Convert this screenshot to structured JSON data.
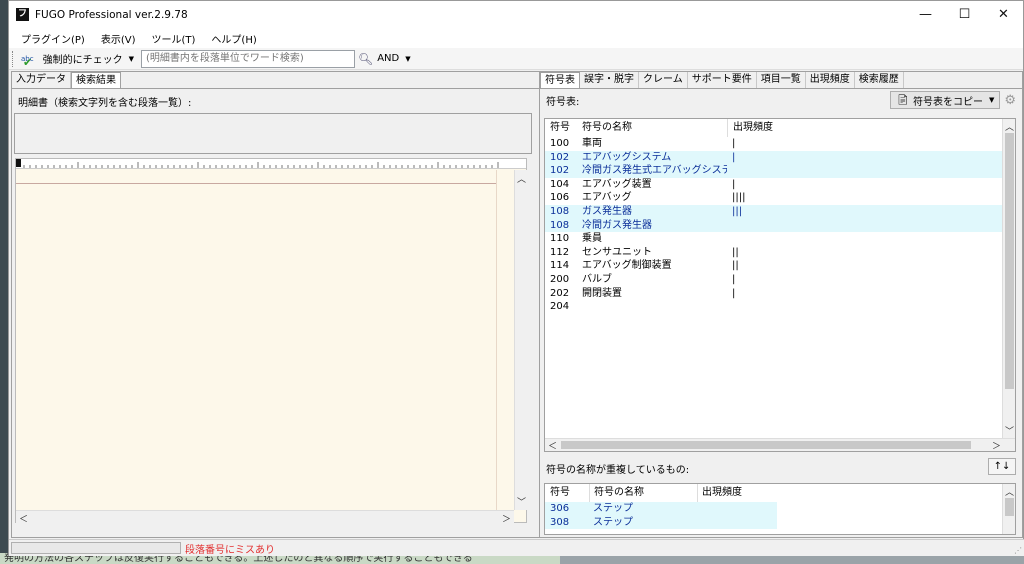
{
  "app": {
    "title": "FUGO Professional ver.2.9.78"
  },
  "background": {
    "bottom_text": "発明の方法の各ステップは反復実行することもできる。上述したのと異なる順序で実行することもできる"
  },
  "menu": [
    "プラグイン(P)",
    "表示(V)",
    "ツール(T)",
    "ヘルプ(H)"
  ],
  "toolbar": {
    "check_label": "強制的にチェック",
    "search_placeholder": "(明細書内を段落単位でワード検索)",
    "operator": "AND"
  },
  "left_panel": {
    "tabs": [
      "入力データ",
      "検索結果"
    ],
    "active_tab": 1,
    "section_label": "明細書（検索文字列を含む段落一覧）:"
  },
  "right_panel": {
    "tabs": [
      "符号表",
      "誤字・脱字",
      "クレーム",
      "サポート要件",
      "項目一覧",
      "出現頻度",
      "検索履歴"
    ],
    "active_tab": 0,
    "table_label": "符号表:",
    "copy_button": "符号表をコピー",
    "columns": [
      "符号",
      "符号の名称",
      "出現頻度"
    ],
    "rows": [
      {
        "num": "100",
        "name": "車両",
        "freq": "|",
        "hl": false
      },
      {
        "num": "102",
        "name": "エアバッグシステム",
        "freq": "|",
        "hl": true
      },
      {
        "num": "102",
        "name": "冷間ガス発生式エアバッグシステム",
        "freq": "",
        "hl": true
      },
      {
        "num": "104",
        "name": "エアバッグ装置",
        "freq": "|",
        "hl": false
      },
      {
        "num": "106",
        "name": "エアバッグ",
        "freq": "||||",
        "hl": false
      },
      {
        "num": "108",
        "name": "ガス発生器",
        "freq": "|||",
        "hl": true
      },
      {
        "num": "108",
        "name": "冷間ガス発生器",
        "freq": "",
        "hl": true
      },
      {
        "num": "110",
        "name": "乗員",
        "freq": "",
        "hl": false
      },
      {
        "num": "112",
        "name": "センサユニット",
        "freq": "||",
        "hl": false
      },
      {
        "num": "114",
        "name": "エアバッグ制御装置",
        "freq": "||",
        "hl": false
      },
      {
        "num": "200",
        "name": "バルブ",
        "freq": "|",
        "hl": false
      },
      {
        "num": "202",
        "name": "開閉装置",
        "freq": "|",
        "hl": false
      },
      {
        "num": "204",
        "name": "",
        "freq": "",
        "hl": false
      }
    ],
    "dup_label": "符号の名称が重複しているもの:",
    "sort_button": "↑↓",
    "dup_columns": [
      "符号",
      "符号の名称",
      "出現頻度"
    ],
    "dup_rows": [
      {
        "num": "306",
        "name": "ステップ",
        "freq": ""
      },
      {
        "num": "308",
        "name": "ステップ",
        "freq": ""
      }
    ]
  },
  "status": {
    "message": "段落番号にミスあり"
  },
  "colors": {
    "highlight_bg": "#e0f8fc",
    "highlight_text": "#0b2f99",
    "error_text": "#e23030"
  }
}
